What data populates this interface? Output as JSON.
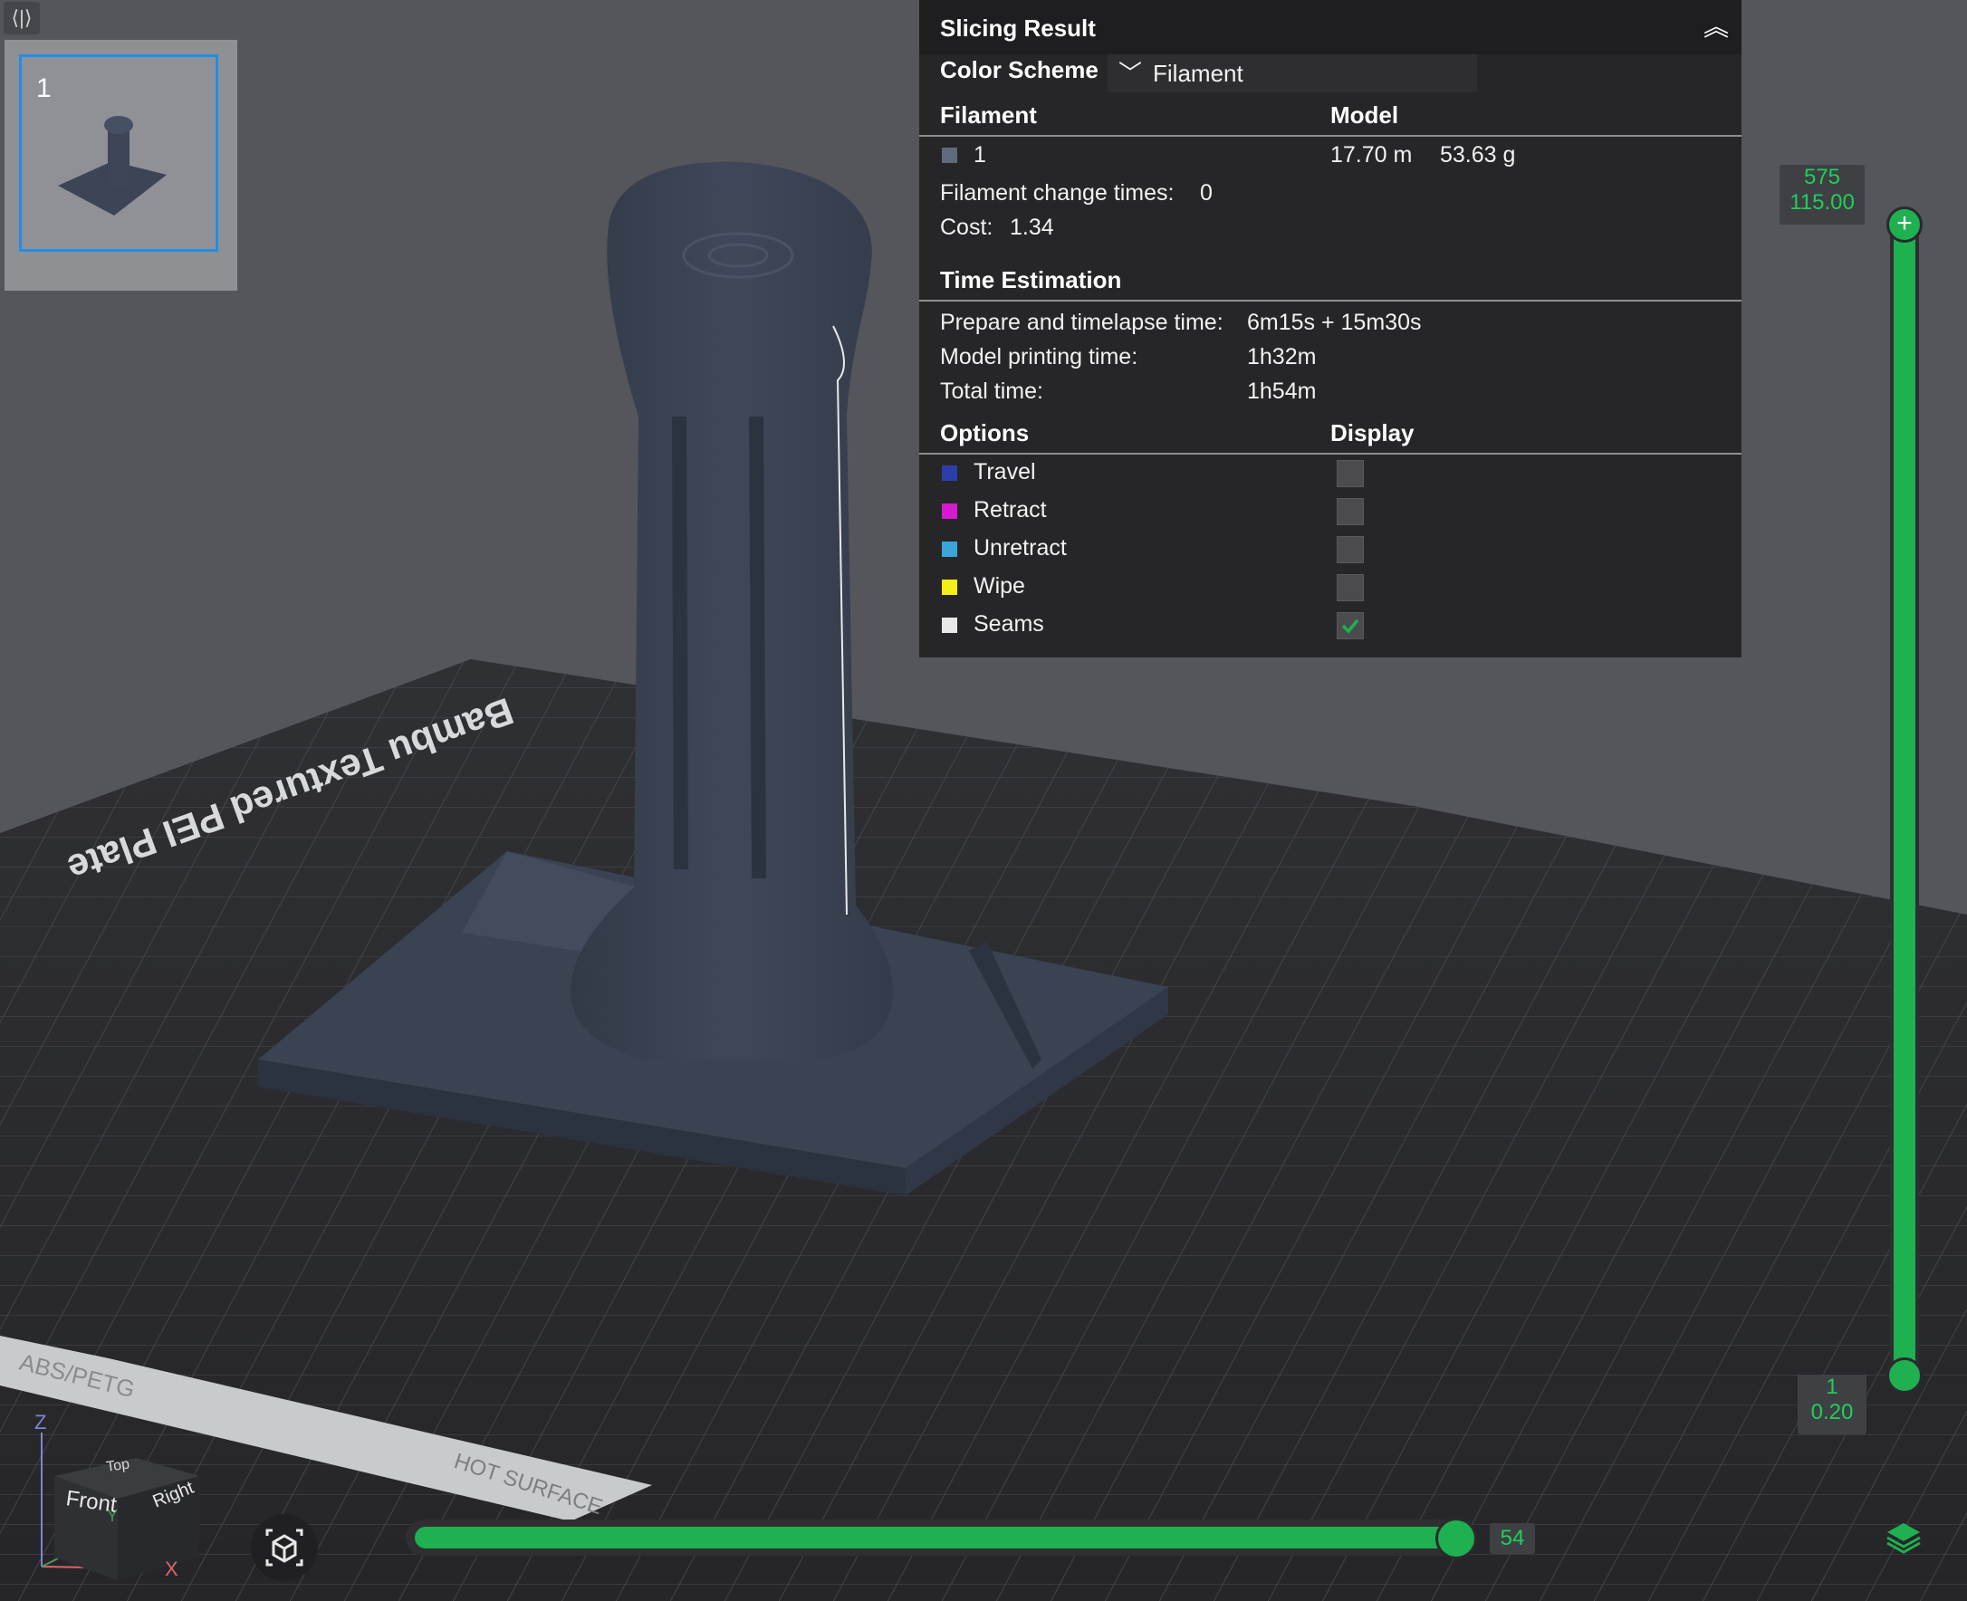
{
  "plate": {
    "number": "1"
  },
  "bed": {
    "label": "Bambu Textured PEI Plate",
    "strip_text": "ABS/PETG",
    "hot_label": "HOT SURFACE"
  },
  "result": {
    "title": "Slicing Result",
    "color_scheme_label": "Color Scheme",
    "color_scheme_value": "Filament",
    "col_filament": "Filament",
    "col_model": "Model",
    "filament_id": "1",
    "filament_length": "17.70 m",
    "filament_weight": "53.63 g",
    "change_label": "Filament change times:",
    "change_value": "0",
    "cost_label": "Cost:",
    "cost_value": "1.34",
    "time_title": "Time Estimation",
    "prepare_label": "Prepare and timelapse time:",
    "prepare_value": "6m15s + 15m30s",
    "model_time_label": "Model printing time:",
    "model_time_value": "1h32m",
    "total_label": "Total time:",
    "total_value": "1h54m",
    "options_label": "Options",
    "display_label": "Display",
    "options": [
      {
        "label": "Travel",
        "color": "#2c3ea8",
        "checked": false
      },
      {
        "label": "Retract",
        "color": "#d61ad1",
        "checked": false
      },
      {
        "label": "Unretract",
        "color": "#3aa6d8",
        "checked": false
      },
      {
        "label": "Wipe",
        "color": "#f4ef16",
        "checked": false
      },
      {
        "label": "Seams",
        "color": "#e8e8e8",
        "checked": true
      }
    ],
    "filament_color": "#5f6a7c"
  },
  "layer_slider": {
    "top_layer": "575",
    "top_height": "115.00",
    "bottom_layer": "1",
    "bottom_height": "0.20"
  },
  "move_slider": {
    "value": "54"
  },
  "orientation": {
    "z": "Z",
    "x": "X",
    "y": "Y",
    "top": "Top",
    "front": "Front",
    "right": "Right"
  },
  "colors": {
    "accent": "#1fb050",
    "panel": "#262628",
    "model": "#3b4453"
  }
}
